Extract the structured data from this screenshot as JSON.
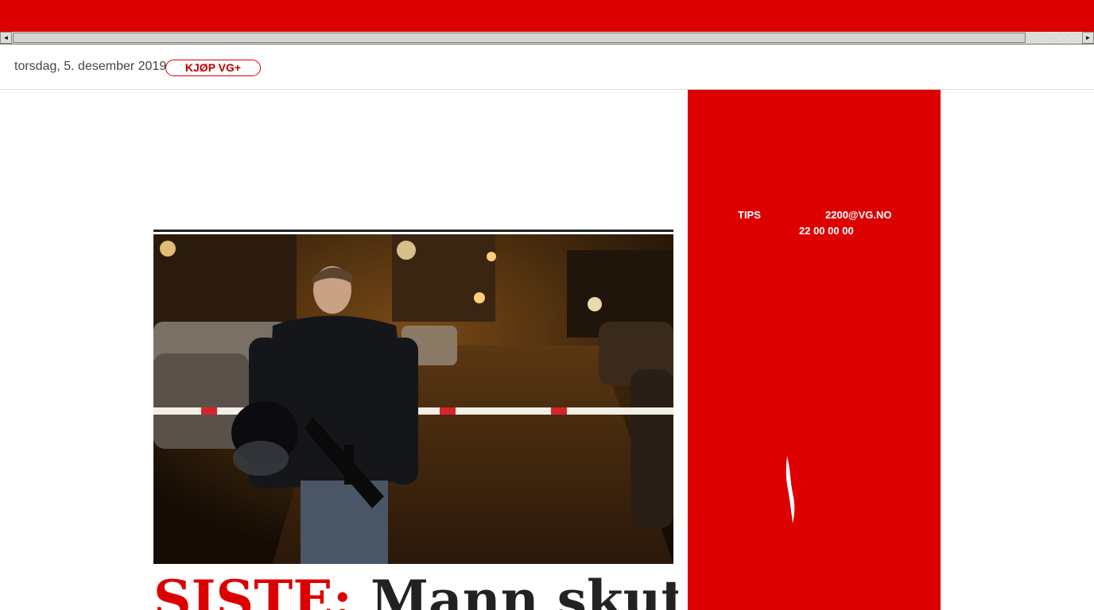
{
  "header": {
    "date": "torsdag, 5. desember 2019",
    "buy_label": "KJØP VG+"
  },
  "article": {
    "kicker": "SISTE:",
    "headline": "Mann skutt i"
  },
  "tips": {
    "label": "TIPS",
    "email": "2200@VG.NO",
    "phone": "22 00 00 00"
  },
  "icons": {
    "scroll_left": "scroll-left-arrow",
    "scroll_right": "scroll-right-arrow",
    "brand_mark": "flame-icon"
  },
  "colors": {
    "brand_red": "#dd0000",
    "text_dark": "#222222"
  }
}
